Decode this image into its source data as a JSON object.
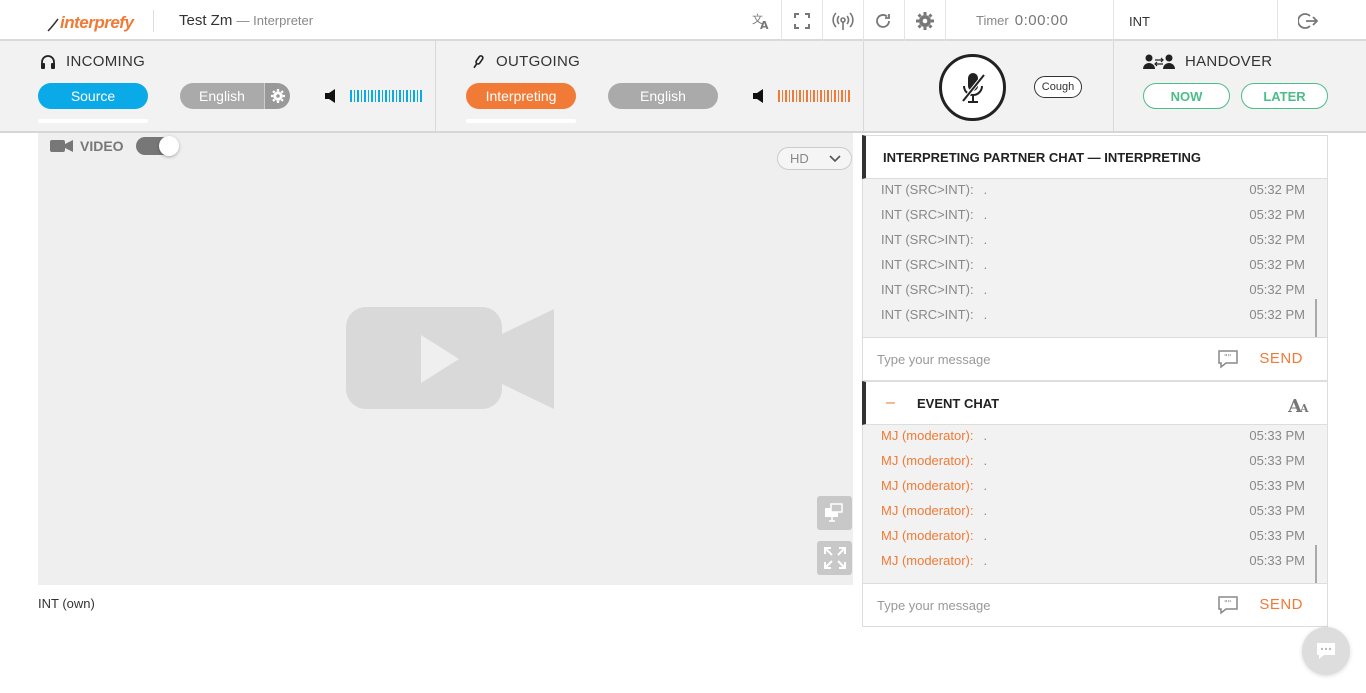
{
  "app": {
    "brand": "interprefy",
    "title": "Test Zm",
    "role": "— Interpreter",
    "timer_label": "Timer",
    "timer_value": "0:00:00",
    "user": "INT"
  },
  "toolbar": {
    "icons": [
      "translate-icon",
      "fullscreen-icon",
      "broadcast-icon",
      "refresh-icon",
      "gear-icon",
      "logout-icon"
    ]
  },
  "incoming": {
    "title": "INCOMING",
    "source_label": "Source",
    "language": "English"
  },
  "outgoing": {
    "title": "OUTGOING",
    "interpreting_label": "Interpreting",
    "language": "English"
  },
  "mic": {
    "cough_label": "Cough"
  },
  "handover": {
    "title": "HANDOVER",
    "now_label": "NOW",
    "later_label": "LATER"
  },
  "video": {
    "label": "VIDEO",
    "quality": "HD",
    "own_label": "INT (own)"
  },
  "partner_chat": {
    "title": "INTERPRETING PARTNER CHAT — INTERPRETING",
    "messages": [
      {
        "who": "INT (SRC>INT):",
        "text": ".",
        "time": "05:32 PM"
      },
      {
        "who": "INT (SRC>INT):",
        "text": ".",
        "time": "05:32 PM"
      },
      {
        "who": "INT (SRC>INT):",
        "text": ".",
        "time": "05:32 PM"
      },
      {
        "who": "INT (SRC>INT):",
        "text": ".",
        "time": "05:32 PM"
      },
      {
        "who": "INT (SRC>INT):",
        "text": ".",
        "time": "05:32 PM"
      },
      {
        "who": "INT (SRC>INT):",
        "text": ".",
        "time": "05:32 PM"
      }
    ],
    "input_placeholder": "Type your message",
    "send_label": "SEND"
  },
  "event_chat": {
    "title": "EVENT CHAT",
    "collapse_symbol": "–",
    "messages": [
      {
        "who": "MJ (moderator):",
        "text": ".",
        "time": "05:33 PM"
      },
      {
        "who": "MJ (moderator):",
        "text": ".",
        "time": "05:33 PM"
      },
      {
        "who": "MJ (moderator):",
        "text": ".",
        "time": "05:33 PM"
      },
      {
        "who": "MJ (moderator):",
        "text": ".",
        "time": "05:33 PM"
      },
      {
        "who": "MJ (moderator):",
        "text": ".",
        "time": "05:33 PM"
      },
      {
        "who": "MJ (moderator):",
        "text": ".",
        "time": "05:33 PM"
      }
    ],
    "input_placeholder": "Type your message",
    "send_label": "SEND"
  },
  "colors": {
    "accent_orange": "#f07a36",
    "accent_blue": "#0aa9e8",
    "handover_green": "#4bbd8a"
  }
}
